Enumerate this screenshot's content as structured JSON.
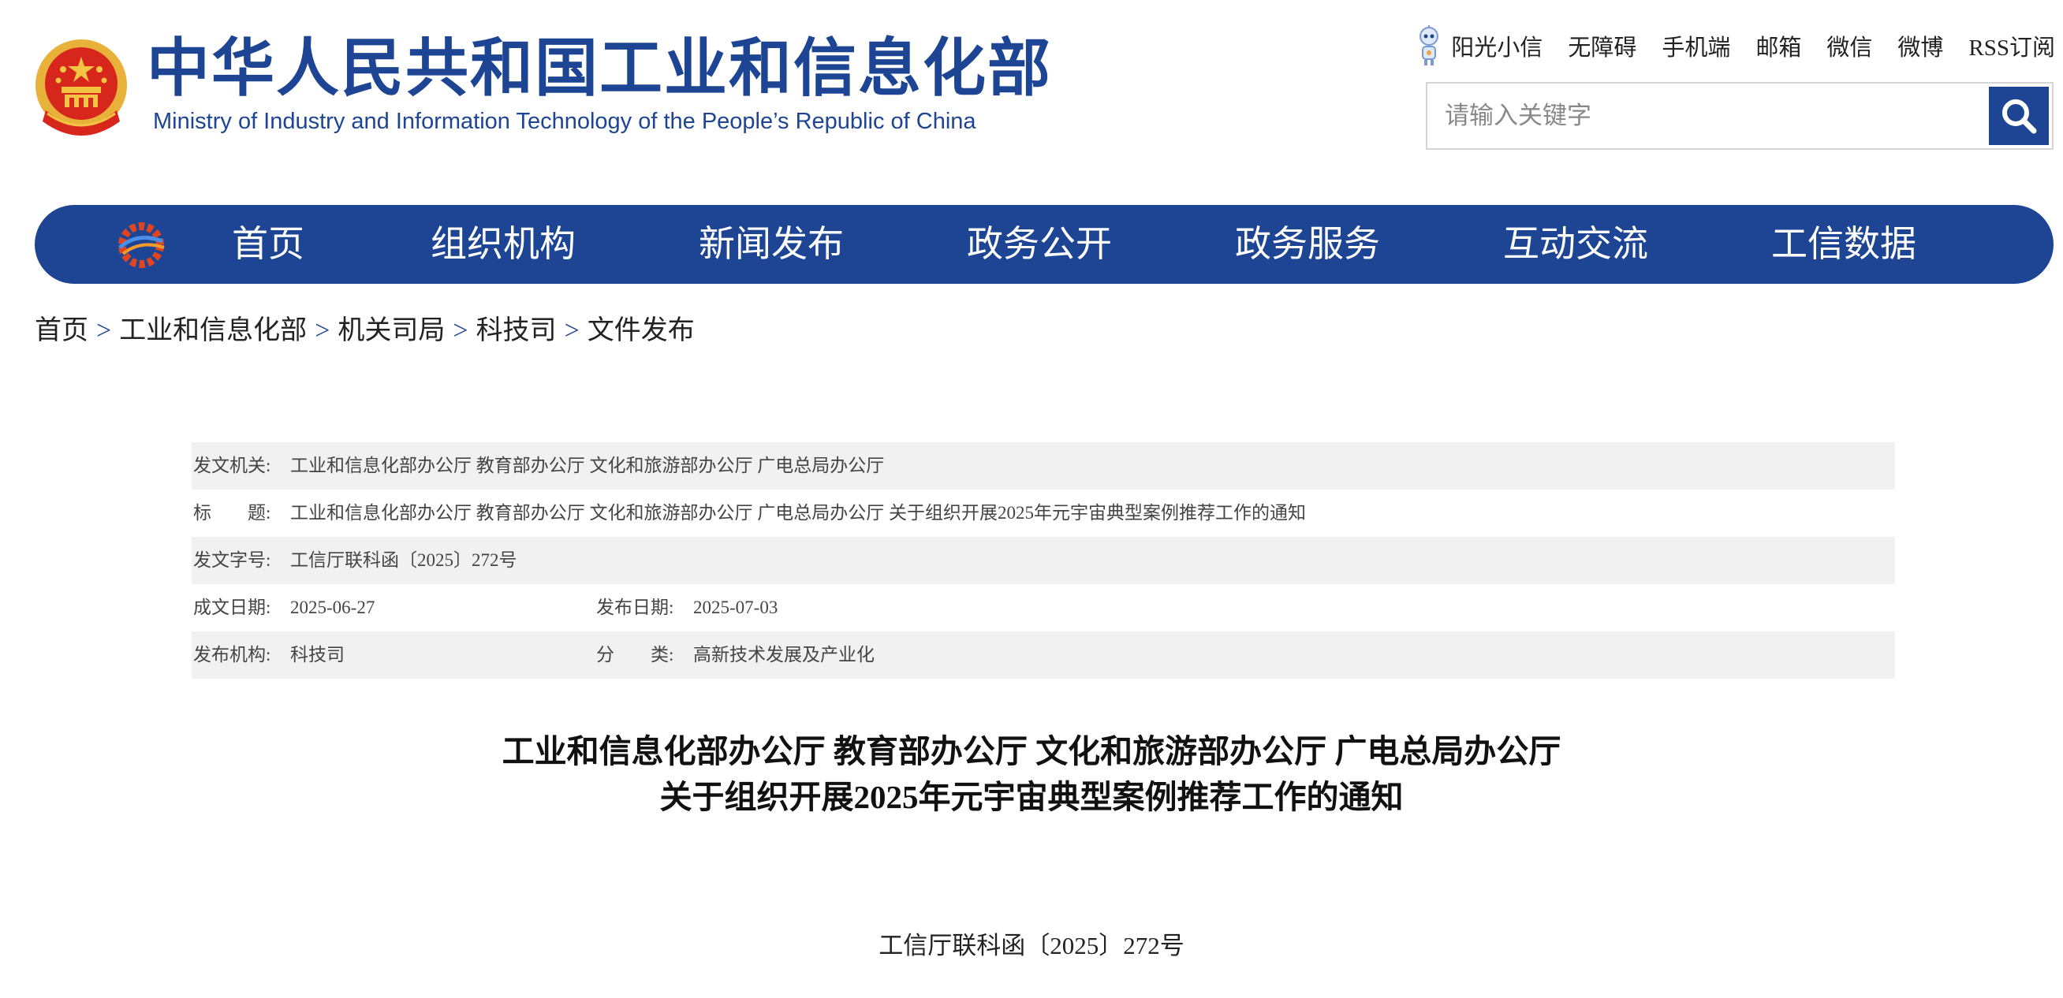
{
  "header": {
    "logo_cn": "中华人民共和国工业和信息化部",
    "logo_en": "Ministry of Industry and Information Technology of the People’s Republic of China",
    "top_links": [
      "阳光小信",
      "无障碍",
      "手机端",
      "邮箱",
      "微信",
      "微博",
      "RSS订阅"
    ],
    "search_placeholder": "请输入关键字",
    "search_icon": "search-icon",
    "robot_icon": "robot-icon"
  },
  "nav": {
    "items": [
      "首页",
      "组织机构",
      "新闻发布",
      "政务公开",
      "政务服务",
      "互动交流",
      "工信数据"
    ]
  },
  "breadcrumb": {
    "items": [
      "首页",
      "工业和信息化部",
      "机关司局",
      "科技司",
      "文件发布"
    ],
    "separator": ">"
  },
  "meta": {
    "issuer_label": "发文机关:",
    "issuer": "工业和信息化部办公厅 教育部办公厅 文化和旅游部办公厅 广电总局办公厅",
    "title_label": "标　　题:",
    "title": "工业和信息化部办公厅 教育部办公厅 文化和旅游部办公厅 广电总局办公厅 关于组织开展2025年元宇宙典型案例推荐工作的通知",
    "doc_number_label": "发文字号:",
    "doc_number": "工信厅联科函〔2025〕272号",
    "written_date_label": "成文日期:",
    "written_date": "2025-06-27",
    "publish_date_label": "发布日期:",
    "publish_date": "2025-07-03",
    "publisher_label": "发布机构:",
    "publisher": "科技司",
    "category_label": "分　　类:",
    "category": "高新技术发展及产业化"
  },
  "document": {
    "title_line1": "工业和信息化部办公厅 教育部办公厅 文化和旅游部办公厅 广电总局办公厅",
    "title_line2": "关于组织开展2025年元宇宙典型案例推荐工作的通知",
    "number": "工信厅联科函〔2025〕272号"
  },
  "colors": {
    "brand_blue": "#1d4593",
    "meta_row_shade": "#f1f1f1"
  }
}
